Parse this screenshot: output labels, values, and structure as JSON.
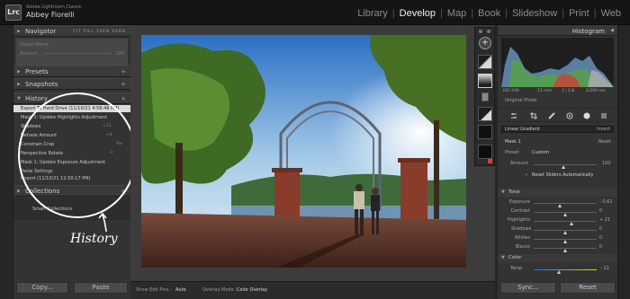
{
  "app": {
    "logo_text": "Lrc",
    "app_name": "Adobe Lightroom Classic",
    "user_name": "Abbey Fiorelli"
  },
  "modules": {
    "items": [
      "Library",
      "Develop",
      "Map",
      "Book",
      "Slideshow",
      "Print",
      "Web"
    ],
    "active": "Develop"
  },
  "left_panel": {
    "navigator": {
      "title": "Navigator",
      "zoom_options": [
        "FIT",
        "FILL",
        "100%",
        "200%"
      ],
      "preset_name": "Preset Name",
      "amount_label": "Amount",
      "amount_value": "100"
    },
    "presets_title": "Presets",
    "snapshots_title": "Snapshots",
    "history_title": "History",
    "history_items": [
      {
        "label": "Export To Hard Drive (11/10/21 4:56:46 PM)",
        "value": "",
        "selected": true
      },
      {
        "label": "Mask 1: Update Highlights Adjustment",
        "value": "",
        "selected": false
      },
      {
        "label": "Shadows",
        "value": "+11",
        "selected": false
      },
      {
        "label": "Dehaze Amount",
        "value": "+4",
        "selected": false
      },
      {
        "label": "Constrain Crop",
        "value": "Yes",
        "selected": false
      },
      {
        "label": "Perspective Rotate",
        "value": "-1",
        "selected": false
      },
      {
        "label": "Mask 1: Update Exposure Adjustment",
        "value": "",
        "selected": false
      },
      {
        "label": "Paste Settings",
        "value": "",
        "selected": false
      },
      {
        "label": "Import (11/10/21 12:50:17 PM)",
        "value": "",
        "selected": false
      }
    ],
    "collections_title": "Collections",
    "smart_collections": "Smart Collections",
    "copy_button": "Copy...",
    "paste_button": "Paste"
  },
  "annotation": {
    "handwritten": "History"
  },
  "bottom_toolbar": {
    "show_edit_pins_label": "Show Edit Pins :",
    "show_edit_pins_value": "Auto",
    "overlay_mode_label": "Overlay Mode :",
    "overlay_mode_value": "Color Overlay"
  },
  "right_panel": {
    "histogram_title": "Histogram",
    "meta": {
      "iso": "ISO 200",
      "focal": "11 mm",
      "aperture": "ƒ / 2.8",
      "shutter": "1/200 sec"
    },
    "original_photo": "Original Photo",
    "mask_dropdown": "Linear Gradient",
    "invert_label": "Invert",
    "mask_name": "Mask 1",
    "reset_label": "Reset",
    "preset_label": "Preset",
    "preset_value": "Custom",
    "amount_label": "Amount",
    "amount_value": "100",
    "reset_sliders": "Reset Sliders Automatically",
    "tone_section": "Tone",
    "tone_sliders": [
      {
        "label": "Exposure",
        "value": "- 0.61",
        "position": 0.42
      },
      {
        "label": "Contrast",
        "value": "0",
        "position": 0.5
      },
      {
        "label": "Highlights",
        "value": "+ 21",
        "position": 0.6
      },
      {
        "label": "Shadows",
        "value": "0",
        "position": 0.5
      },
      {
        "label": "Whites",
        "value": "0",
        "position": 0.5
      },
      {
        "label": "Blacks",
        "value": "0",
        "position": 0.5
      }
    ],
    "color_section": "Color",
    "temp_label": "Temp",
    "temp_value": "- 22",
    "temp_position": 0.41,
    "sync_button": "Sync...",
    "reset_button": "Reset"
  }
}
